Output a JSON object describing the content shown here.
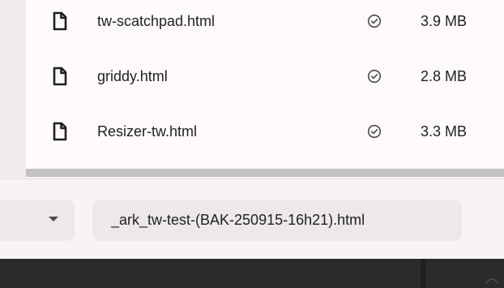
{
  "files": [
    {
      "name": "tw-scatchpad.html",
      "size": "3.9 MB",
      "status_icon": "check-circle-icon",
      "type_icon": "file-icon"
    },
    {
      "name": "griddy.html",
      "size": "2.8 MB",
      "status_icon": "check-circle-icon",
      "type_icon": "file-icon"
    },
    {
      "name": "Resizer-tw.html",
      "size": "3.3 MB",
      "status_icon": "check-circle-icon",
      "type_icon": "file-icon"
    }
  ],
  "footer": {
    "filename_value": "_ark_tw-test-(BAK-250915-16h21).html",
    "type_select_icon": "chevron-down-icon"
  },
  "colors": {
    "background": "#f8f4f6",
    "list_background": "#fffbfc",
    "field_background": "#ede9eb",
    "scrollbar": "#c4c1c3",
    "taskbar": "#2b2b2b"
  }
}
